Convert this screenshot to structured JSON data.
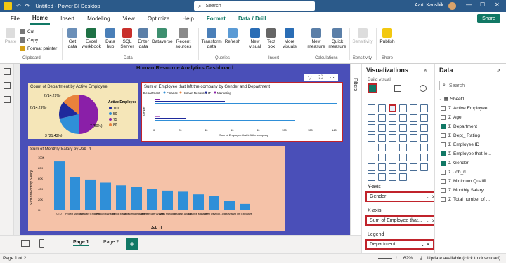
{
  "titlebar": {
    "title": "Untitled - Power BI Desktop",
    "search": "Search",
    "user": "Aarti Kaushik"
  },
  "menu": {
    "items": [
      "File",
      "Home",
      "Insert",
      "Modeling",
      "View",
      "Optimize",
      "Help",
      "Format",
      "Data / Drill"
    ],
    "share": "Share"
  },
  "ribbon": {
    "paste": "Paste",
    "cut": "Cut",
    "copy": "Copy",
    "format_painter": "Format painter",
    "get_data": "Get data",
    "excel": "Excel workbook",
    "data_hub": "Data hub",
    "sql": "SQL Server",
    "enter_data": "Enter data",
    "dataverse": "Dataverse",
    "recent": "Recent sources",
    "transform": "Transform data",
    "refresh": "Refresh",
    "new_visual": "New visual",
    "text_box": "Text box",
    "more_visuals": "More visuals",
    "new_measure": "New measure",
    "quick_measure": "Quick measure",
    "sensitivity": "Sensitivity",
    "publish": "Publish",
    "g_clipboard": "Clipboard",
    "g_data": "Data",
    "g_queries": "Queries",
    "g_insert": "Insert",
    "g_calc": "Calculations",
    "g_sens": "Sensitivity",
    "g_share": "Share"
  },
  "report": {
    "title": "Human Resource Analytics Dashboard",
    "pie": {
      "title": "Count of Department by Active Employee",
      "legend_title": "Active Employee",
      "legend": [
        {
          "label": "100",
          "color": "#1f2a9c"
        },
        {
          "label": "50",
          "color": "#2f8fd8"
        },
        {
          "label": "75",
          "color": "#8a1fa8"
        },
        {
          "label": "80",
          "color": "#e9823c"
        }
      ],
      "labels": [
        "2 (14.29%)",
        "2 (14.29%)",
        "3 (21.43%)",
        "7 (50%)"
      ]
    },
    "bar": {
      "title": "Sum of Employee that left the company by Gender and Department",
      "legend_label": "Department",
      "legend": [
        {
          "label": "Finance",
          "color": "#2f8fd8"
        },
        {
          "label": "Human Resource",
          "color": "#e9823c"
        },
        {
          "label": "IT",
          "color": "#1f2a9c"
        },
        {
          "label": "Marketing",
          "color": "#8a1fa8"
        }
      ],
      "xticks": [
        "0",
        "20",
        "40",
        "60",
        "80",
        "100",
        "120",
        "140"
      ],
      "xlabel": "Sum of Employee that left the company",
      "ylabel": "Gender"
    },
    "col": {
      "title": "Sum of Monthly Salary by Job_rl",
      "ylabel": "Sum of Monthly Salary",
      "xlabel": "Job_rl",
      "yticks": [
        "100K",
        "80K",
        "60K",
        "40K",
        "20K",
        "0K"
      ],
      "cats": [
        "CTO",
        "Project Manager",
        "Software Engineer",
        "Product Manager",
        "Senior Manager",
        "Sr. Software Engineer",
        "Cyber Security Analyst",
        "Sales Manager",
        "Business Analyst",
        "Finance Manager",
        "Web Develop...",
        "Data Analyst",
        "HR Executive"
      ]
    }
  },
  "filters_label": "Filters",
  "viz": {
    "title": "Visualizations",
    "build": "Build visual",
    "yaxis": "Y-axis",
    "yaxis_val": "Gender",
    "xaxis": "X-axis",
    "xaxis_val": "Sum of Employee that...",
    "legend": "Legend",
    "legend_val": "Department"
  },
  "data": {
    "title": "Data",
    "search": "Search",
    "table": "Sheet1",
    "fields": [
      "Active Employee",
      "Age",
      "Department",
      "Dept_ Rating",
      "Employee ID",
      "Employee that le...",
      "Gender",
      "Job_rl",
      "Minimum Qualifi...",
      "Monthly Salary",
      "Total number of ..."
    ]
  },
  "pages": {
    "p1": "Page 1",
    "p2": "Page 2"
  },
  "status": {
    "page": "Page 1 of 2",
    "zoom": "62%",
    "update": "Update available (click to download)"
  }
}
